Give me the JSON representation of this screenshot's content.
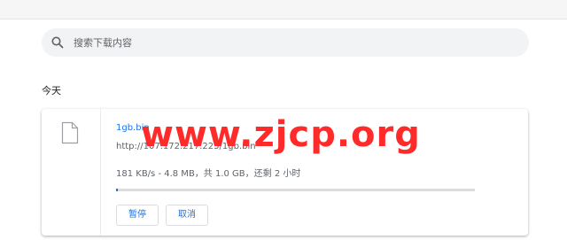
{
  "search": {
    "placeholder": "搜索下载内容",
    "icon": "search-icon"
  },
  "section": {
    "title": "今天"
  },
  "download": {
    "file_name": "1gb.bin",
    "url": "http://107.172.217.223/1gb.bin",
    "status": "181 KB/s - 4.8 MB，共 1.0 GB，还剩 2 小时",
    "progress_fraction": 0.0047,
    "file_icon": "file-icon",
    "pause_label": "暂停",
    "cancel_label": "取消"
  },
  "watermark": {
    "text": "www.zjcp.org"
  },
  "colors": {
    "accent": "#1a73e8",
    "watermark": "#ff2a2a",
    "search_bg": "#f1f3f4"
  }
}
